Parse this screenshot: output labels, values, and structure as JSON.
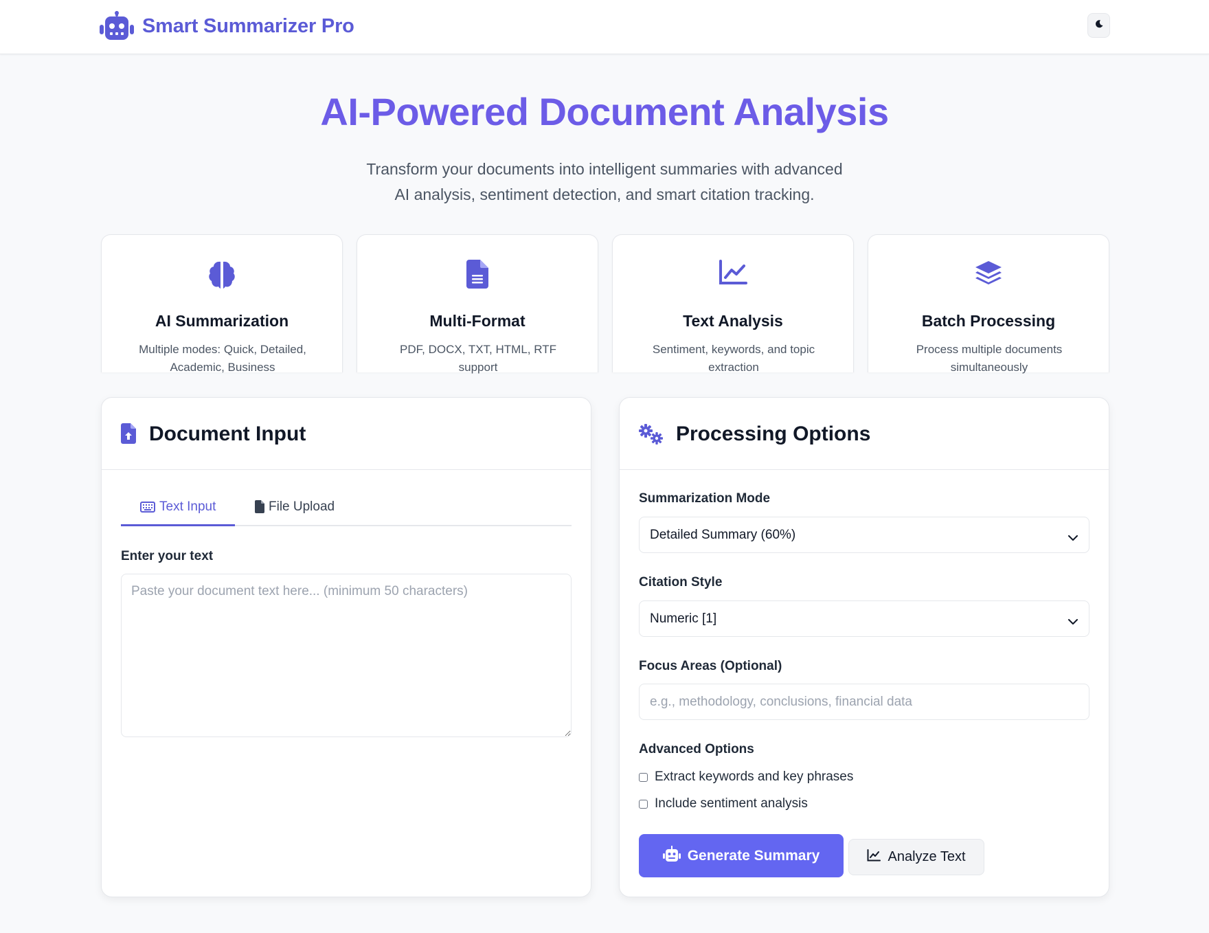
{
  "app": {
    "name": "Smart Summarizer Pro",
    "brand_color": "#5b5bd6",
    "accent_color": "#6366f1",
    "logo_icon": "robot-icon",
    "theme_toggle_icon": "moon-icon"
  },
  "hero": {
    "title": "AI-Powered Document Analysis",
    "subtitle": "Transform your documents into intelligent summaries with advanced AI analysis, sentiment detection, and smart citation tracking."
  },
  "features": [
    {
      "icon": "brain-icon",
      "title": "AI Summarization",
      "description": "Multiple modes: Quick, Detailed, Academic, Business"
    },
    {
      "icon": "file-icon",
      "title": "Multi-Format",
      "description": "PDF, DOCX, TXT, HTML, RTF support"
    },
    {
      "icon": "line-chart-icon",
      "title": "Text Analysis",
      "description": "Sentiment, keywords, and topic extraction"
    },
    {
      "icon": "layers-icon",
      "title": "Batch Processing",
      "description": "Process multiple documents simultaneously"
    }
  ],
  "document_input": {
    "icon": "file-upload-icon",
    "title": "Document Input",
    "tabs": [
      {
        "icon": "keyboard-icon",
        "label": "Text Input",
        "active": true
      },
      {
        "icon": "file-icon",
        "label": "File Upload",
        "active": false
      }
    ],
    "text_label": "Enter your text",
    "text_value": "",
    "text_placeholder": "Paste your document text here... (minimum 50 characters)"
  },
  "processing_options": {
    "icon": "gears-icon",
    "title": "Processing Options",
    "mode_label": "Summarization Mode",
    "mode_value": "Detailed Summary (60%)",
    "citation_label": "Citation Style",
    "citation_value": "Numeric [1]",
    "focus_label": "Focus Areas (Optional)",
    "focus_value": "",
    "focus_placeholder": "e.g., methodology, conclusions, financial data",
    "advanced_label": "Advanced Options",
    "options": [
      {
        "label": "Extract keywords and key phrases",
        "checked": false
      },
      {
        "label": "Include sentiment analysis",
        "checked": false
      }
    ],
    "generate_button": "Generate Summary",
    "analyze_button": "Analyze Text"
  }
}
